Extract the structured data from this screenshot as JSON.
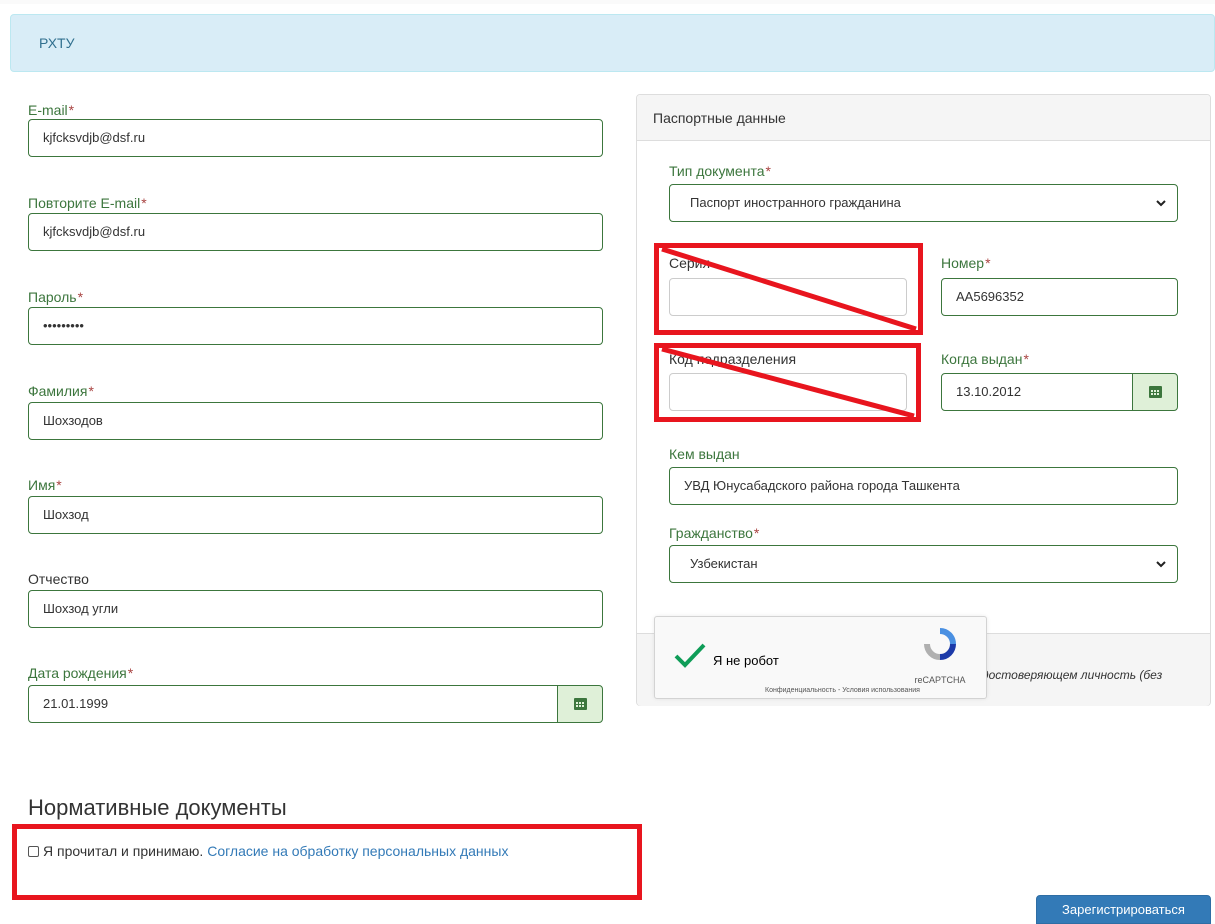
{
  "header": {
    "org": "РХТУ"
  },
  "left_form": {
    "email": {
      "label": "E-mail",
      "value": "kjfcksvdjb@dsf.ru"
    },
    "email_repeat": {
      "label": "Повторите E-mail",
      "value": "kjfcksvdjb@dsf.ru"
    },
    "password": {
      "label": "Пароль",
      "value": "•••••••••"
    },
    "last_name": {
      "label": "Фамилия",
      "value": "Шохзодов"
    },
    "first_name": {
      "label": "Имя",
      "value": "Шохзод"
    },
    "patronymic": {
      "label": "Отчество",
      "value": "Шохзод угли"
    },
    "birth_date": {
      "label": "Дата рождения",
      "value": "21.01.1999"
    },
    "required_mark": "*"
  },
  "passport": {
    "title": "Паспортные данные",
    "doc_type": {
      "label": "Тип документа",
      "value": "Паспорт иностранного гражданина"
    },
    "series": {
      "label": "Серия",
      "value": ""
    },
    "number": {
      "label": "Номер",
      "value": "AA5696352"
    },
    "division_code": {
      "label": "Код подразделения",
      "value": ""
    },
    "issue_date": {
      "label": "Когда выдан",
      "value": "13.10.2012"
    },
    "issued_by": {
      "label": "Кем выдан",
      "value": "УВД Юнусабадского района города Ташкента"
    },
    "citizenship": {
      "label": "Гражданство",
      "value": "Узбекистан"
    },
    "footer_note": "достоверяющем личность (без"
  },
  "captcha": {
    "label": "Я не робот",
    "brand": "reCAPTCHA",
    "links": "Конфиденциальность - Условия использования"
  },
  "documents": {
    "title": "Нормативные документы",
    "agree_text": "Я прочитал и принимаю.",
    "agree_link": "Согласие на обработку персональных данных",
    "checked": false
  },
  "submit_label": "Зарегистрироваться",
  "colors": {
    "valid": "#3c763d",
    "required": "#a94442",
    "alert_bg": "#d9edf7",
    "primary": "#337ab7",
    "annotation": "#e8151e"
  }
}
